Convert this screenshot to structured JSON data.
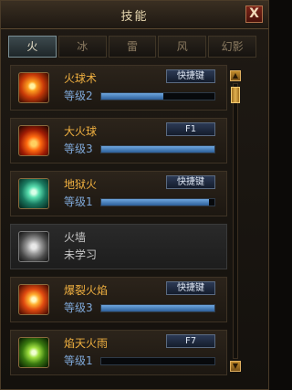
{
  "window": {
    "title": "技能",
    "close_label": "X"
  },
  "tabs": [
    {
      "label": "火",
      "active": true
    },
    {
      "label": "冰",
      "active": false
    },
    {
      "label": "雷",
      "active": false
    },
    {
      "label": "风",
      "active": false
    },
    {
      "label": "幻影",
      "active": false
    }
  ],
  "skills": [
    {
      "name": "火球术",
      "level": "等级2",
      "hotkey": "快捷键",
      "progress": 0.55,
      "icon": "fireball-icon"
    },
    {
      "name": "大火球",
      "level": "等级3",
      "hotkey": "F1",
      "progress": 1.0,
      "icon": "big-fireball-icon"
    },
    {
      "name": "地狱火",
      "level": "等级1",
      "hotkey": "快捷键",
      "progress": 0.95,
      "icon": "hellfire-icon"
    },
    {
      "name": "火墙",
      "level": "未学习",
      "hotkey": "",
      "progress": null,
      "icon": "firewall-icon"
    },
    {
      "name": "爆裂火焰",
      "level": "等级3",
      "hotkey": "快捷键",
      "progress": 1.0,
      "icon": "explosive-flame-icon"
    },
    {
      "name": "焰天火雨",
      "level": "等级1",
      "hotkey": "F7",
      "progress": 0.0,
      "icon": "fire-rain-icon"
    }
  ]
}
